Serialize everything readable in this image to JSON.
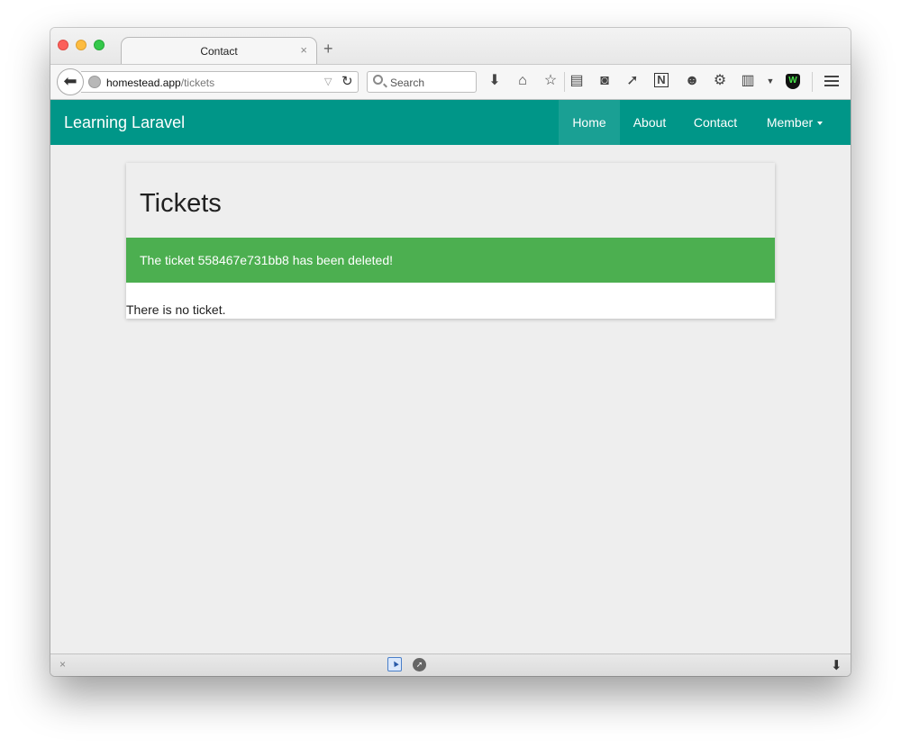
{
  "browser": {
    "tab_title": "Contact",
    "tab_close": "×",
    "new_tab": "+",
    "url_host": "homestead.app",
    "url_path": "/tickets",
    "search_placeholder": "Search",
    "toolbar_icons": [
      "download-icon",
      "home-icon",
      "bookmark-star-icon",
      "reading-list-icon",
      "pocket-icon",
      "send-icon",
      "evernote-icon",
      "chat-icon",
      "extension-icon",
      "clipboard-icon",
      "shield-icon",
      "menu-icon"
    ]
  },
  "site": {
    "brand": "Learning Laravel",
    "nav": {
      "home": "Home",
      "about": "About",
      "contact": "Contact",
      "member": "Member"
    },
    "nav_color": "#009688"
  },
  "panel": {
    "title": "Tickets",
    "alert": "The ticket 558467e731bb8 has been deleted!",
    "alert_color": "#4caf50",
    "empty_message": "There is no ticket."
  },
  "statusbar": {
    "close": "×"
  }
}
